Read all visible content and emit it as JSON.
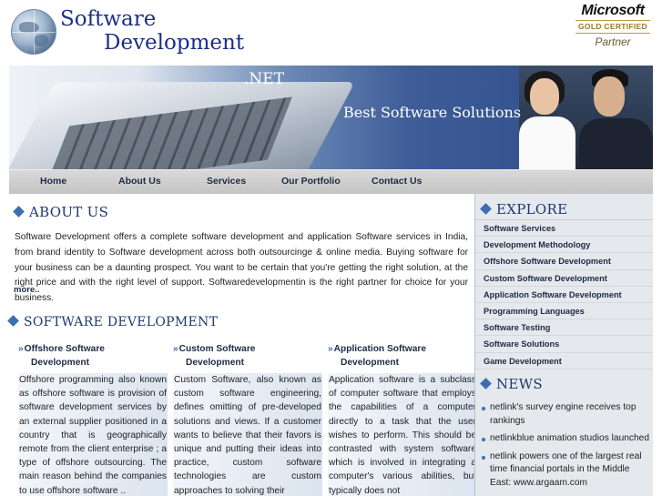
{
  "header": {
    "logo_line1": "Software",
    "logo_line2": "Development",
    "partner": {
      "brand": "Microsoft",
      "level": "GOLD CERTIFIED",
      "label": "Partner"
    }
  },
  "banner": {
    "domain_suffix": ".NET",
    "tagline": "Best Software Solutions"
  },
  "nav": {
    "items": [
      "Home",
      "About Us",
      "Services",
      "Our Portfolio",
      "Contact Us"
    ]
  },
  "about": {
    "heading": "ABOUT US",
    "text": "Software Development offers a complete software development and application Software services in India, from brand identity to Software development across both outsourcinge & online media. Buying software for your business can be a daunting prospect. You want to be certain that you're getting the right solution, at the right price and with the right level of support. Softwaredevelopmentin is the right partner for choice for your business.",
    "more_link": "more.."
  },
  "software_development": {
    "heading": "SOFTWARE DEVELOPMENT",
    "columns": [
      {
        "title_line1": "Offshore Software",
        "title_line2": "Development",
        "text": "Offshore programming also known as offshore software is provision of software development services by an external supplier positioned in a country that is geographically remote from the client enterprise ; a type of offshore outsourcing. The main reason behind the companies to use offshore software .."
      },
      {
        "title_line1": "Custom Software",
        "title_line2": "Development",
        "text": "Custom Software, also known as custom software engineering, defines omitting of pre-developed solutions and views. If a customer wants to believe that their favors is unique and putting their ideas into practice, custom software technologies are custom approaches to solving their"
      },
      {
        "title_line1": "Application Software",
        "title_line2": "Development",
        "text": "Application software is a subclass of computer software that employs the capabilities of a computer directly to a task that the user wishes to perform. This should be contrasted with system software which is involved in integrating a computer's various abilities, but typically does not"
      }
    ]
  },
  "explore": {
    "heading": "EXPLORE",
    "items": [
      "Software Services",
      "Development Methodology",
      "Offshore Software Development",
      "Custom Software Development",
      "Application Software Development",
      "Programming Languages",
      "Software Testing",
      "Software Solutions",
      "Game Development"
    ]
  },
  "news": {
    "heading": "NEWS",
    "items": [
      "netlink's survey engine receives top rankings",
      "netlinkblue animation studios launched",
      "netlink powers one of the largest real time financial portals in the Middle East: www.argaam.com"
    ]
  },
  "colors": {
    "heading": "#1e3a70",
    "accent": "#3b6fb0",
    "nav_bg": "#c4c4c4",
    "sidebar_bg": "#e5e8ec"
  },
  "icons": {
    "logo": "globe-icon",
    "heading_marker": "diamond-icon",
    "column_marker": "double-chevron-icon",
    "news_marker": "bullet-icon"
  }
}
